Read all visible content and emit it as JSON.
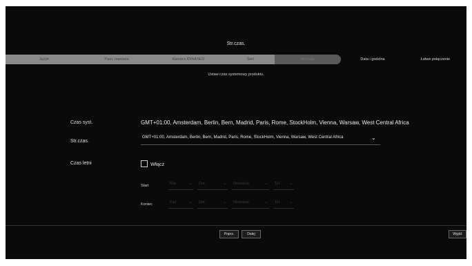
{
  "title": "Str.czas.",
  "steps": [
    {
      "label": "Język",
      "state": "done"
    },
    {
      "label": "Parn. masowa",
      "state": "done"
    },
    {
      "label": "Kamera ID/HASŁO",
      "state": "done"
    },
    {
      "label": "Sieć",
      "state": "done"
    },
    {
      "label": "Str.czas.",
      "state": "active"
    },
    {
      "label": "Data i godzina",
      "state": "todo"
    },
    {
      "label": "Łatwe połączenie",
      "state": "todo"
    }
  ],
  "subtitle": "Ustaw czas systemowy produktu.",
  "form": {
    "system_time_label": "Czas syst.",
    "system_time_value": "GMT+01:00, Amsterdam, Berlin, Bern, Madrid, Paris, Rome, StockHolm, Vienna, Warsaw, West Central Africa",
    "timezone_label": "Str.czas.",
    "timezone_value": "GMT+01:00, Amsterdam, Berlin, Bern, Madrid, Paris, Rome, StockHolm, Vienna, Warsaw, West Central Africa",
    "dst_label": "Czas letni",
    "dst_enable_label": "Włącz",
    "dst_enabled": false,
    "start_label": "Start",
    "start": {
      "month": "Mar",
      "week": "Ost.",
      "day": "Niedziela",
      "hour": "1H"
    },
    "end_label": "Koniec",
    "end": {
      "month": "Paź",
      "week": "Ost.",
      "day": "Niedziela",
      "hour": "1H"
    }
  },
  "buttons": {
    "prev": "Poprz.",
    "next": "Dalej",
    "exit": "Wyjdź"
  },
  "colors": {
    "background": "#0a0a0a",
    "step_done": "#8a8a8a",
    "step_active": "#5a5a5a"
  }
}
